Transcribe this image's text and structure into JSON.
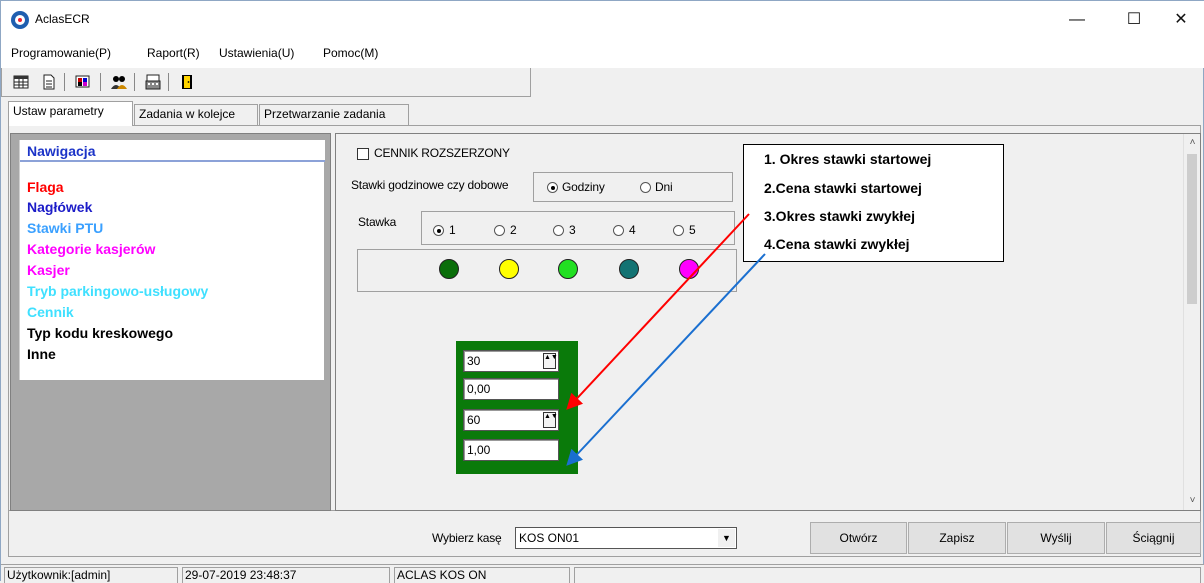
{
  "window": {
    "title": "AclasECR"
  },
  "window_controls": {
    "minimize": "—",
    "maximize": "☐",
    "close": "✕"
  },
  "menu": [
    "Programowanie(P)",
    "Raport(R)",
    "Ustawienia(U)",
    "Pomoc(M)"
  ],
  "tabs": [
    "Ustaw parametry",
    "Zadania w kolejce",
    "Przetwarzanie zadania"
  ],
  "nav": {
    "header": "Nawigacja",
    "items": [
      {
        "label": "Flaga",
        "color": "#ff0000"
      },
      {
        "label": "Nagłówek",
        "color": "#1c1cc8"
      },
      {
        "label": "Stawki PTU",
        "color": "#3aa0ff"
      },
      {
        "label": "Kategorie kasjerów",
        "color": "#ff00ff"
      },
      {
        "label": "Kasjer",
        "color": "#ff00ff"
      },
      {
        "label": "Tryb parkingowo-usługowy",
        "color": "#3fe0ff"
      },
      {
        "label": "Cennik",
        "color": "#3fe0ff"
      },
      {
        "label": "Typ kodu kreskowego",
        "color": "#000000"
      },
      {
        "label": "Inne",
        "color": "#000000"
      }
    ]
  },
  "form": {
    "extended_pricelist_label": "CENNIK ROZSZERZONY",
    "extended_pricelist_checked": false,
    "rate_mode_label": "Stawki godzinowe czy dobowe",
    "rate_mode_options": [
      "Godziny",
      "Dni"
    ],
    "rate_mode_selected": "Godziny",
    "rate_label": "Stawka",
    "rate_options": [
      "1",
      "2",
      "3",
      "4",
      "5"
    ],
    "rate_selected": "1",
    "rate_colors": [
      "#0a6e0a",
      "#ffff00",
      "#22e022",
      "#137373",
      "#ff00ff"
    ],
    "fields": {
      "start_period": "30",
      "start_price": "0,00",
      "regular_period": "60",
      "regular_price": "1,00"
    },
    "spin_glyph": "▲▼"
  },
  "callout": {
    "lines": [
      "1. Okres stawki startowej",
      "2.Cena stawki startowej",
      "3.Okres stawki zwykłej",
      "4.Cena stawki zwykłej"
    ],
    "arrow_colors": [
      "#ff0000",
      "#1a6fd0"
    ]
  },
  "bottom": {
    "select_label": "Wybierz kasę",
    "select_value": "KOS ON01",
    "dropdown_glyph": "▼",
    "buttons": [
      "Otwórz",
      "Zapisz",
      "Wyślij",
      "Ściągnij"
    ]
  },
  "status": {
    "user": "Użytkownik:[admin]",
    "datetime": "29-07-2019 23:48:37",
    "device": "ACLAS KOS ON"
  },
  "scroll_glyphs": {
    "up": "˄",
    "down": "˅"
  }
}
